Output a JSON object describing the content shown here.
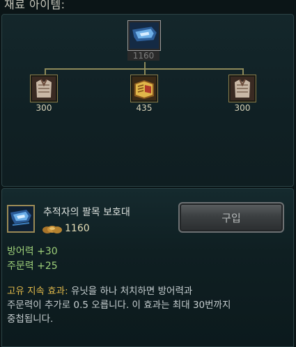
{
  "header": {
    "title": "재료 아이템:"
  },
  "recipe_tree": {
    "result": {
      "icon": "wrist-guard-icon",
      "price": "1160"
    },
    "components": [
      {
        "icon": "cloth-armor-icon",
        "price": "300"
      },
      {
        "icon": "spellbook-icon",
        "price": "435"
      },
      {
        "icon": "cloth-armor-icon",
        "price": "300"
      }
    ]
  },
  "item": {
    "icon": "wrist-guard-icon",
    "name": "추적자의 팔목 보호대",
    "coins_icon": "gold-coins-icon",
    "cost": "1160",
    "buy_label": "구입",
    "stats": [
      "방어력 +30",
      "주문력 +25"
    ],
    "passive_label": "고유 지속 효과:",
    "passive_text_line1": " 유닛을 하나 처치하면 방어력과",
    "passive_text_line2": "주문력이 추가로 0.5 오릅니다.  이 효과는 최대 30번까지",
    "passive_text_line3": "중첩됩니다."
  },
  "colors": {
    "background": "#0b1517",
    "stat_green": "#9ed07a",
    "passive_gold": "#e1b94a",
    "frame_gold": "#8b7e4a"
  }
}
